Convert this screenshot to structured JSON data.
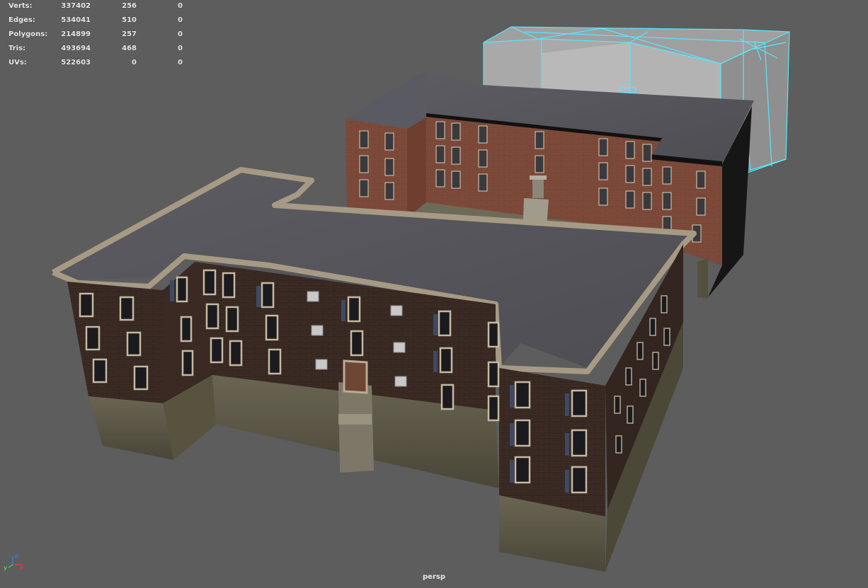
{
  "hud": {
    "rows": [
      {
        "label": "Verts:",
        "values": [
          "337402",
          "256",
          "0"
        ]
      },
      {
        "label": "Edges:",
        "values": [
          "534041",
          "510",
          "0"
        ]
      },
      {
        "label": "Polygons:",
        "values": [
          "214899",
          "257",
          "0"
        ]
      },
      {
        "label": "Tris:",
        "values": [
          "493694",
          "468",
          "0"
        ]
      },
      {
        "label": "UVs:",
        "values": [
          "522603",
          "0",
          "0"
        ]
      }
    ]
  },
  "viewport": {
    "camera": "persp",
    "background": "#5d5d5d",
    "selection_color": "#55e8ff"
  },
  "axis": {
    "x": "x",
    "y": "y",
    "z": "z"
  }
}
